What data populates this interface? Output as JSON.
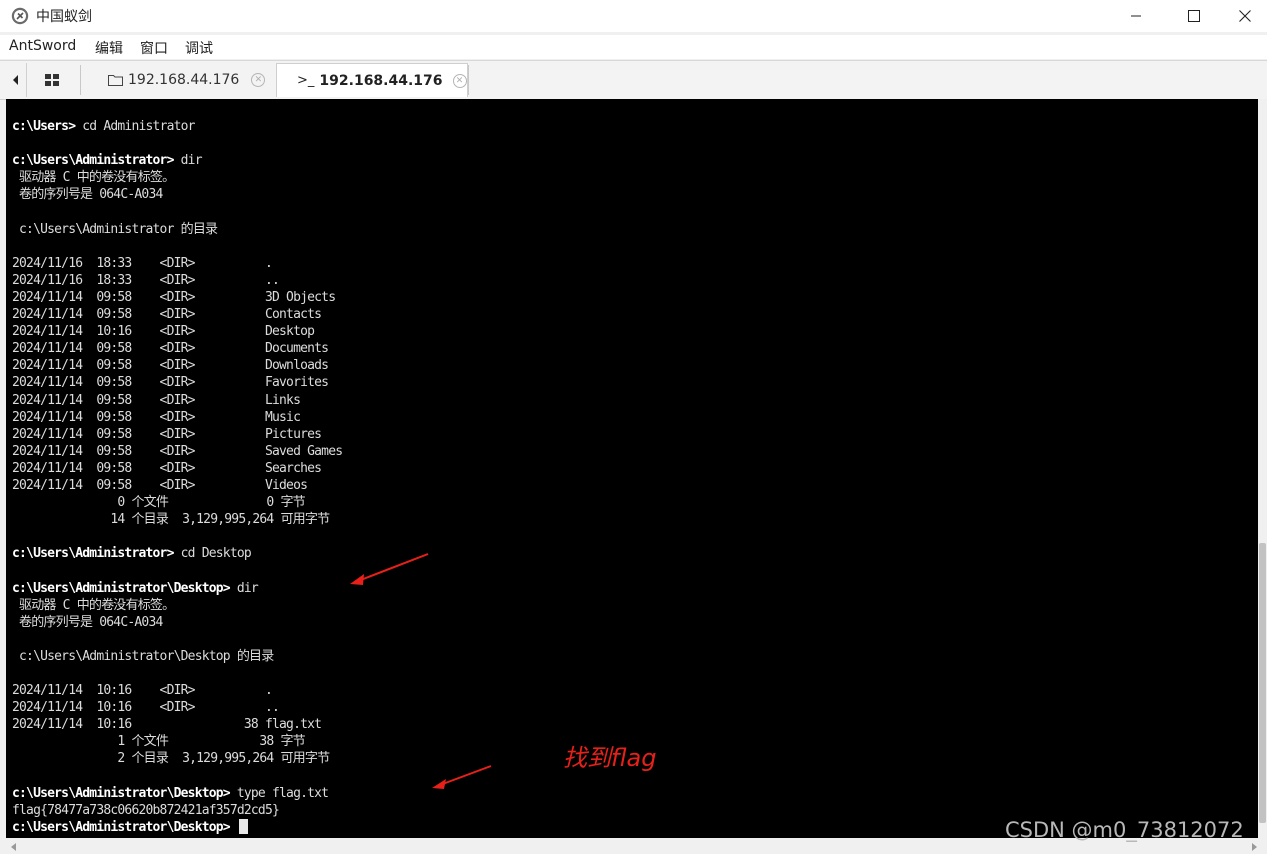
{
  "window": {
    "title": "中国蚁剑",
    "minimize_icon": "minimize-icon",
    "maximize_icon": "maximize-icon",
    "close_icon": "close-icon"
  },
  "menu": [
    "AntSword",
    "编辑",
    "窗口",
    "调试"
  ],
  "tabs": [
    {
      "icon": "folder-icon",
      "label": "192.168.44.176",
      "active": false
    },
    {
      "icon": "terminal-icon",
      "label": "192.168.44.176",
      "active": true
    }
  ],
  "terminal": {
    "lines": [
      {
        "prompt": "c:\\Users>",
        "text": " cd Administrator"
      },
      {
        "prompt": "",
        "text": ""
      },
      {
        "prompt": "c:\\Users\\Administrator>",
        "text": " dir"
      },
      {
        "prompt": "",
        "text": " 驱动器 C 中的卷没有标签。"
      },
      {
        "prompt": "",
        "text": " 卷的序列号是 064C-A034"
      },
      {
        "prompt": "",
        "text": ""
      },
      {
        "prompt": "",
        "text": " c:\\Users\\Administrator 的目录"
      },
      {
        "prompt": "",
        "text": ""
      },
      {
        "prompt": "",
        "text": "2024/11/16  18:33    <DIR>          ."
      },
      {
        "prompt": "",
        "text": "2024/11/16  18:33    <DIR>          .."
      },
      {
        "prompt": "",
        "text": "2024/11/14  09:58    <DIR>          3D Objects"
      },
      {
        "prompt": "",
        "text": "2024/11/14  09:58    <DIR>          Contacts"
      },
      {
        "prompt": "",
        "text": "2024/11/14  10:16    <DIR>          Desktop"
      },
      {
        "prompt": "",
        "text": "2024/11/14  09:58    <DIR>          Documents"
      },
      {
        "prompt": "",
        "text": "2024/11/14  09:58    <DIR>          Downloads"
      },
      {
        "prompt": "",
        "text": "2024/11/14  09:58    <DIR>          Favorites"
      },
      {
        "prompt": "",
        "text": "2024/11/14  09:58    <DIR>          Links"
      },
      {
        "prompt": "",
        "text": "2024/11/14  09:58    <DIR>          Music"
      },
      {
        "prompt": "",
        "text": "2024/11/14  09:58    <DIR>          Pictures"
      },
      {
        "prompt": "",
        "text": "2024/11/14  09:58    <DIR>          Saved Games"
      },
      {
        "prompt": "",
        "text": "2024/11/14  09:58    <DIR>          Searches"
      },
      {
        "prompt": "",
        "text": "2024/11/14  09:58    <DIR>          Videos"
      },
      {
        "prompt": "",
        "text": "               0 个文件              0 字节"
      },
      {
        "prompt": "",
        "text": "              14 个目录  3,129,995,264 可用字节"
      },
      {
        "prompt": "",
        "text": ""
      },
      {
        "prompt": "c:\\Users\\Administrator>",
        "text": " cd Desktop"
      },
      {
        "prompt": "",
        "text": ""
      },
      {
        "prompt": "c:\\Users\\Administrator\\Desktop>",
        "text": " dir"
      },
      {
        "prompt": "",
        "text": " 驱动器 C 中的卷没有标签。"
      },
      {
        "prompt": "",
        "text": " 卷的序列号是 064C-A034"
      },
      {
        "prompt": "",
        "text": ""
      },
      {
        "prompt": "",
        "text": " c:\\Users\\Administrator\\Desktop 的目录"
      },
      {
        "prompt": "",
        "text": ""
      },
      {
        "prompt": "",
        "text": "2024/11/14  10:16    <DIR>          ."
      },
      {
        "prompt": "",
        "text": "2024/11/14  10:16    <DIR>          .."
      },
      {
        "prompt": "",
        "text": "2024/11/14  10:16                38 flag.txt"
      },
      {
        "prompt": "",
        "text": "               1 个文件             38 字节"
      },
      {
        "prompt": "",
        "text": "               2 个目录  3,129,995,264 可用字节"
      },
      {
        "prompt": "",
        "text": ""
      },
      {
        "prompt": "c:\\Users\\Administrator\\Desktop>",
        "text": " type flag.txt"
      },
      {
        "prompt": "",
        "text": "flag{78477a738c06620b872421af357d2cd5}"
      },
      {
        "prompt": "c:\\Users\\Administrator\\Desktop>",
        "text": " ",
        "cursor": true
      }
    ]
  },
  "annotation": {
    "text": "找到flag",
    "color": "#e8201a"
  },
  "watermark": "CSDN @m0_73812072"
}
